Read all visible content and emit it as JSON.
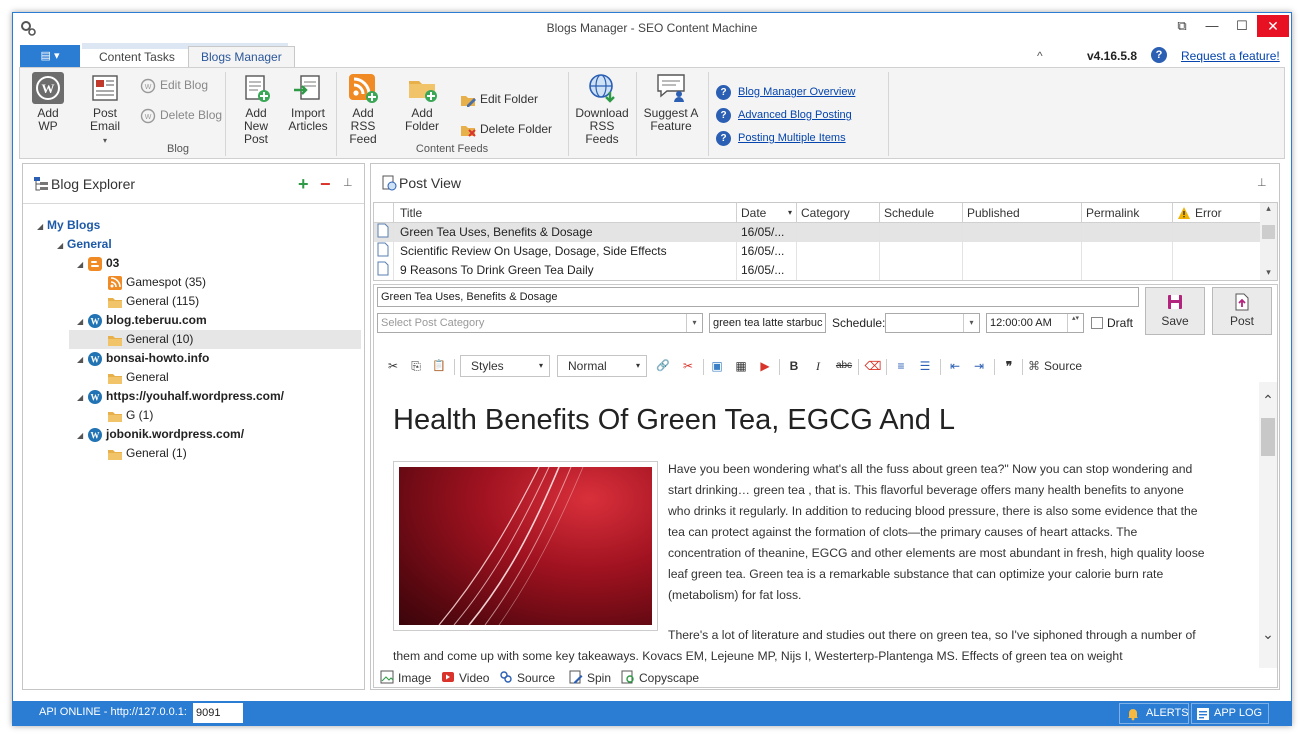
{
  "window": {
    "title": "Blogs Manager - SEO Content Machine",
    "minimize_glyph": "—",
    "restore_glyph": "⧉",
    "maximize_glyph": "☐",
    "close_glyph": "✕",
    "app_icon": "gear-icon"
  },
  "tabs": {
    "file_glyph": "▤ ▾",
    "content_tasks": "Content Tasks",
    "blogs_manager": "Blogs Manager",
    "collapse_glyph": "^",
    "version": "v4.16.5.8",
    "help_glyph": "?",
    "request_link": "Request a feature!"
  },
  "ribbon": {
    "add_wp": "Add WP",
    "post_email": "Post Email",
    "edit_blog": "Edit Blog",
    "delete_blog": "Delete Blog",
    "add_new_post_1": "Add New",
    "add_new_post_2": "Post",
    "import_1": "Import",
    "import_2": "Articles",
    "add_rss_1": "Add RSS",
    "add_rss_2": "Feed",
    "add_folder": "Add Folder",
    "edit_folder": "Edit Folder",
    "delete_folder": "Delete Folder",
    "download_rss_1": "Download",
    "download_rss_2": "RSS Feeds",
    "suggest_1": "Suggest A",
    "suggest_2": "Feature",
    "group_blog": "Blog",
    "group_feeds": "Content Feeds",
    "links": [
      "Blog Manager Overview",
      "Advanced Blog Posting",
      "Posting Multiple Items"
    ],
    "dropdown_glyph": "▾"
  },
  "explorer": {
    "title": "Blog Explorer",
    "add_glyph": "+",
    "remove_glyph": "−",
    "pin_glyph": "⊥",
    "tree_glyph": "◢",
    "nodes": [
      "My Blogs",
      "General",
      "03",
      "Gamespot (35)",
      "General (115)",
      "blog.teberuu.com",
      "General (10)",
      "bonsai-howto.info",
      "General",
      "https://youhalf.wordpress.com/",
      "G (1)",
      "jobonik.wordpress.com/",
      "General (1)"
    ]
  },
  "postview": {
    "title": "Post View",
    "pin_glyph": "⊥",
    "columns": [
      "Title",
      "Date",
      "Category",
      "Schedule",
      "Published",
      "Permalink",
      "Error"
    ],
    "date_sort_glyph": "▾",
    "rows": [
      {
        "title": "Green Tea Uses, Benefits & Dosage",
        "date": "16/05/..."
      },
      {
        "title": "Scientific Review On Usage, Dosage, Side Effects",
        "date": "16/05/..."
      },
      {
        "title": "9 Reasons To Drink Green Tea Daily",
        "date": "16/05/..."
      }
    ],
    "scroll_up": "▴",
    "scroll_down": "▾"
  },
  "editor": {
    "post_title": "Green Tea Uses, Benefits & Dosage",
    "category_placeholder": "Select Post Category",
    "tags": "green tea latte starbuc",
    "schedule_label": "Schedule:",
    "time": "12:00:00 AM",
    "draft_label": "Draft",
    "save_label": "Save",
    "post_label": "Post",
    "styles_combo": "Styles",
    "format_combo": "Normal",
    "source_label": "Source",
    "combo_glyph": "▾",
    "spin_glyph": "▴▾",
    "tool_glyphs": {
      "cut": "✂",
      "copy": "⎘",
      "paste": "📋",
      "link": "🔗",
      "unlink": "✂",
      "image": "▣",
      "table": "▦",
      "youtube": "▶",
      "bold": "B",
      "italic": "I",
      "strike": "abc",
      "eraser": "⌫",
      "ol": "≡",
      "ul": "☰",
      "outdent": "⇤",
      "indent": "⇥",
      "quote": "❞",
      "source": "⌘"
    },
    "heading": "Health Benefits Of Green Tea, EGCG And L",
    "para1": [
      "Have you been wondering what's all the fuss about green tea?\" Now you can stop wondering and",
      "start drinking… green tea , that is. This flavorful beverage offers many health benefits to anyone",
      "who drinks it regularly. In addition to reducing blood pressure, there is also some evidence that the",
      "tea can protect against the formation of clots—the primary causes of heart attacks. The",
      "concentration of theanine, EGCG and other elements are most abundant in fresh, high quality loose",
      "leaf green tea. Green tea is a remarkable substance that can optimize your calorie burn rate",
      "(metabolism) for fat loss."
    ],
    "para2_first": "There's a lot of literature and studies out there on green tea, so I've siphoned through a number of",
    "para2_rest": [
      "them and come up with some key takeaways. Kovacs EM, Lejeune MP, Nijs I, Westerterp-Plantenga MS. Effects of green tea on weight"
    ],
    "scroll_up": "⌃",
    "scroll_down": "⌄",
    "bottom": [
      "Image",
      "Video",
      "Source",
      "Spin",
      "Copyscape"
    ]
  },
  "status": {
    "api": "API ONLINE - http://127.0.0.1:",
    "port": "9091",
    "alerts": "ALERTS",
    "applog": "APP LOG"
  }
}
